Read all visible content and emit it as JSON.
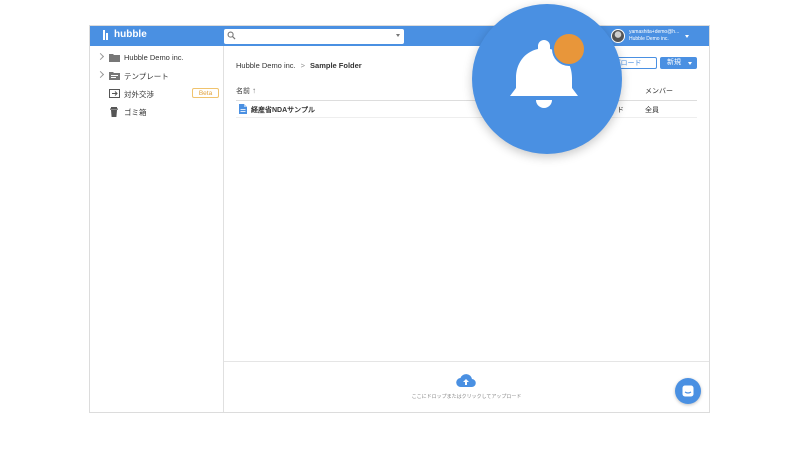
{
  "app": {
    "name": "hubble"
  },
  "search": {
    "placeholder": "",
    "value": ""
  },
  "user": {
    "email": "yamashita+demo@h...",
    "org": "Hubble Demo inc."
  },
  "sidebar": {
    "items": [
      {
        "label": "Hubble Demo inc.",
        "icon": "folder-icon",
        "expandable": true
      },
      {
        "label": "テンプレート",
        "icon": "template-folder-icon",
        "expandable": true
      },
      {
        "label": "対外交渉",
        "icon": "external-negotiation-icon",
        "expandable": false,
        "badge": "Beta"
      },
      {
        "label": "ゴミ箱",
        "icon": "trash-icon",
        "expandable": false
      }
    ]
  },
  "breadcrumb": {
    "root": "Hubble Demo inc.",
    "separator": ">",
    "current": "Sample Folder"
  },
  "toolbar": {
    "upload_label": "ップロード",
    "new_label": "新規"
  },
  "table": {
    "columns": {
      "name": "名前",
      "member": "メンバー"
    },
    "rows": [
      {
        "name": "経産省NDAサンプル",
        "partial": "ド",
        "member": "全員",
        "icon": "document-icon"
      }
    ]
  },
  "dropzone": {
    "text": "ここにドロップまたはクリックしてアップロード",
    "icon": "cloud-upload-icon"
  },
  "chat": {
    "icon": "chat-icon"
  },
  "notification": {
    "icon": "bell-icon",
    "badge_color": "#e8963a"
  },
  "colors": {
    "accent": "#4a90e2",
    "beta": "#e0a13b",
    "notification_badge": "#e8963a"
  }
}
